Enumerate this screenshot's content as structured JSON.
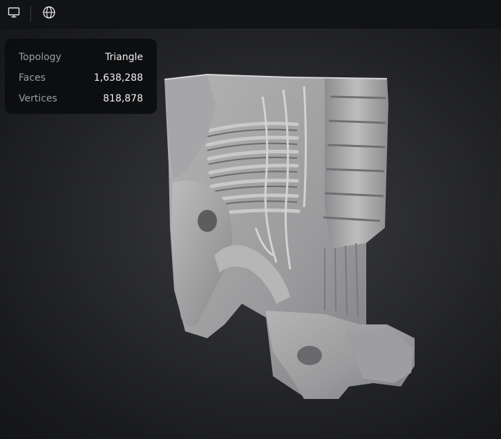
{
  "toolbar": {
    "icons": [
      "monitor-icon",
      "globe-icon"
    ]
  },
  "info_panel": {
    "rows": [
      {
        "label": "Topology",
        "value": "Triangle"
      },
      {
        "label": "Faces",
        "value": "1,638,288"
      },
      {
        "label": "Vertices",
        "value": "818,878"
      }
    ]
  },
  "colors": {
    "background": "#2a2b2f",
    "toolbar": "#121316",
    "panel": "#0c0d0f",
    "model": "#a9a9aa"
  }
}
